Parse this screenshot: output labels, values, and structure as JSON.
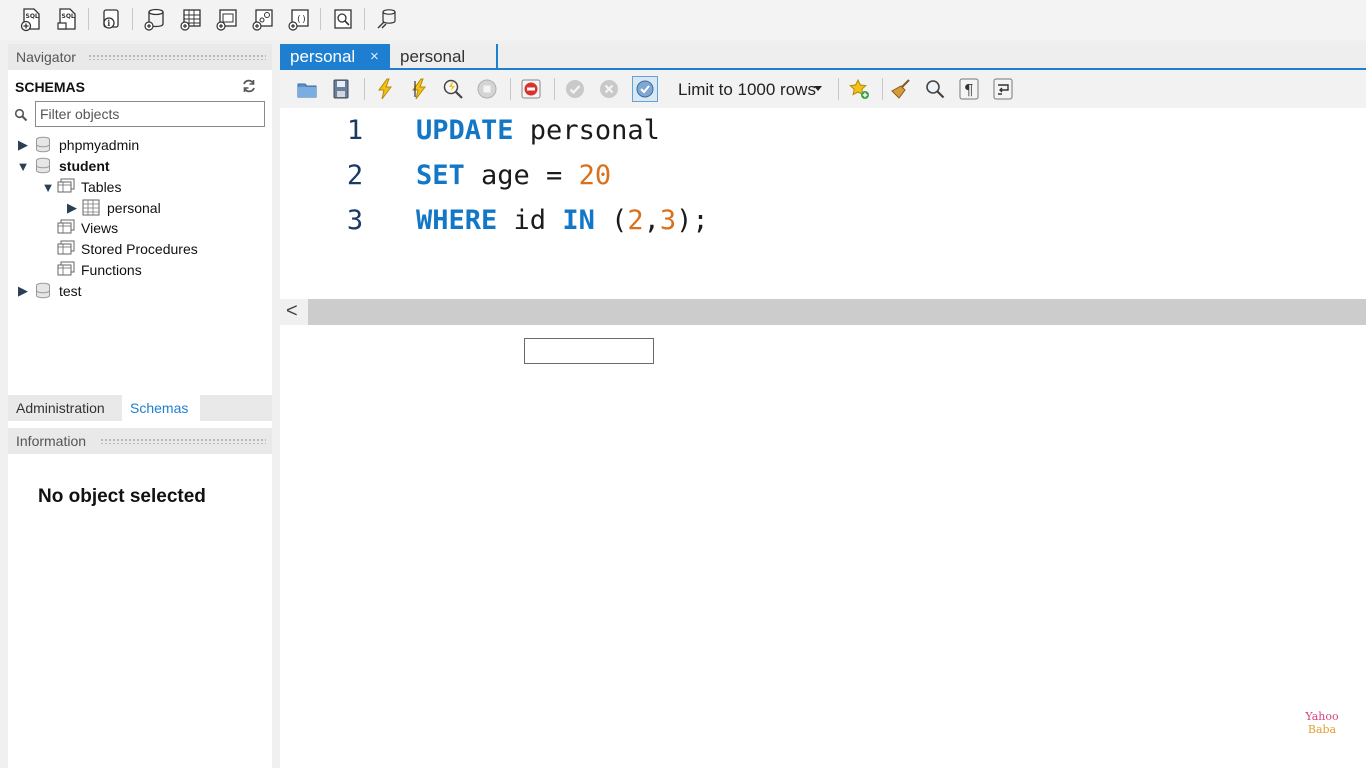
{
  "top_toolbar": {
    "buttons": [
      {
        "icon": "new-sql-tab-icon",
        "text": "SQL"
      },
      {
        "icon": "open-sql-script-icon",
        "text": "SQL"
      },
      {
        "icon": "inspector-icon"
      },
      {
        "icon": "create-schema-icon"
      },
      {
        "icon": "create-table-icon"
      },
      {
        "icon": "create-view-icon"
      },
      {
        "icon": "create-procedure-icon"
      },
      {
        "icon": "create-function-icon"
      },
      {
        "icon": "search-table-data-icon"
      },
      {
        "icon": "reconnect-icon"
      }
    ]
  },
  "navigator": {
    "header": "Navigator",
    "schemas_title": "SCHEMAS",
    "filter_placeholder": "Filter objects",
    "tree": [
      {
        "label": "phpmyadmin",
        "expanded": false,
        "bold": false
      },
      {
        "label": "student",
        "expanded": true,
        "bold": true
      },
      {
        "label": "Tables",
        "expanded": true
      },
      {
        "label": "personal",
        "expanded": false
      },
      {
        "label": "Views"
      },
      {
        "label": "Stored Procedures"
      },
      {
        "label": "Functions"
      },
      {
        "label": "test",
        "expanded": false,
        "bold": false
      }
    ]
  },
  "bottom_tabs": {
    "administration": "Administration",
    "schemas": "Schemas",
    "active": "Schemas"
  },
  "information": {
    "header": "Information",
    "message": "No object selected"
  },
  "editor": {
    "tabs": [
      {
        "label": "personal",
        "active": true,
        "close": "×"
      },
      {
        "label": "personal",
        "active": false
      }
    ],
    "limit": "Limit to 1000 rows",
    "code_lines": [
      {
        "number": "1",
        "tokens": [
          {
            "t": "UPDATE",
            "k": "kw"
          },
          {
            "t": " personal",
            "k": "id"
          }
        ]
      },
      {
        "number": "2",
        "tokens": [
          {
            "t": "SET",
            "k": "kw"
          },
          {
            "t": " age = ",
            "k": "id"
          },
          {
            "t": "20",
            "k": "num"
          }
        ]
      },
      {
        "number": "3",
        "tokens": [
          {
            "t": "WHERE",
            "k": "kw"
          },
          {
            "t": " id ",
            "k": "id"
          },
          {
            "t": "IN",
            "k": "kw"
          },
          {
            "t": " (",
            "k": "id"
          },
          {
            "t": "2",
            "k": "num"
          },
          {
            "t": ",",
            "k": "id"
          },
          {
            "t": "3",
            "k": "num"
          },
          {
            "t": ");",
            "k": "id"
          }
        ]
      }
    ],
    "scroll_left": "<"
  },
  "watermark": {
    "line1": "Yahoo",
    "line2": "Baba"
  },
  "colors": {
    "accent": "#1e7fd0",
    "keyword": "#1277c6",
    "number": "#d9701c"
  }
}
